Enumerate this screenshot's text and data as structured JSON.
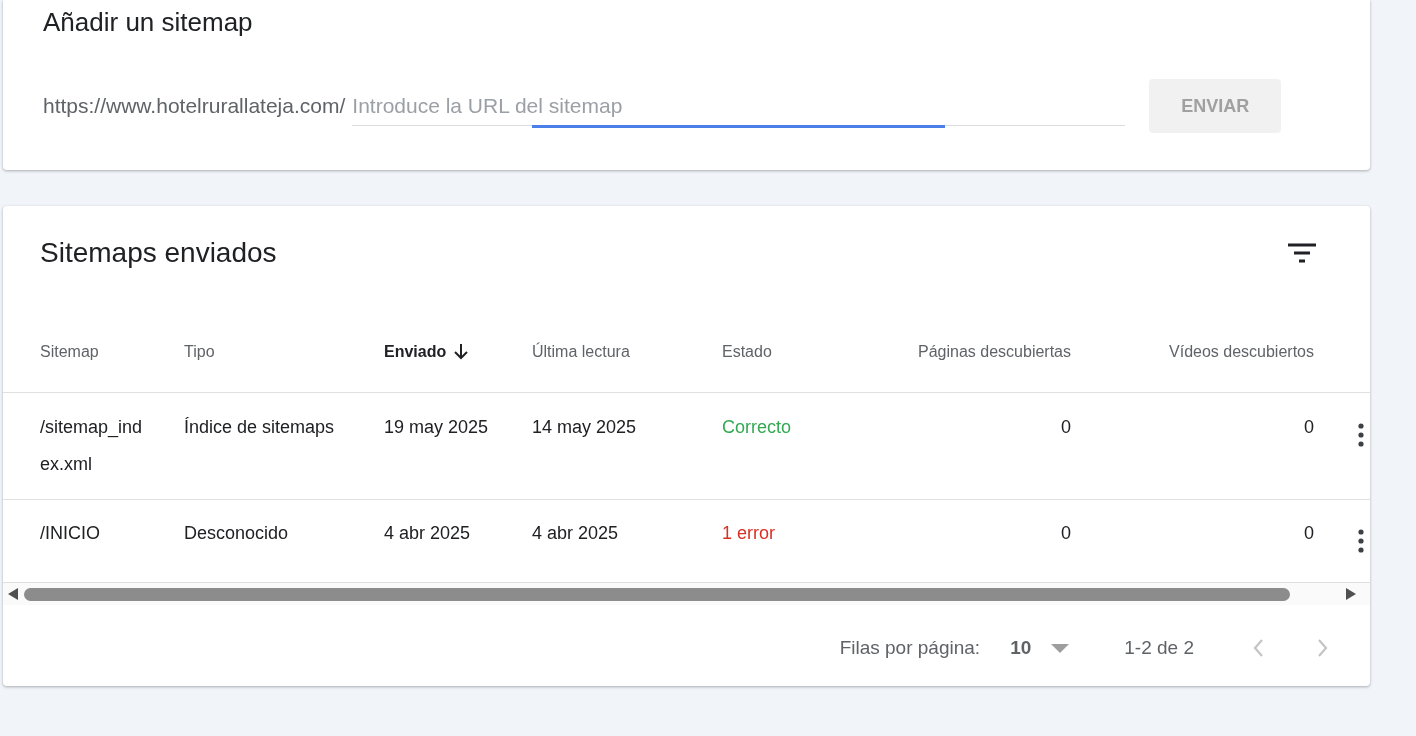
{
  "add_sitemap": {
    "title": "Añadir un sitemap",
    "url_prefix": "https://www.hotelrurallateja.com/",
    "url_field": {
      "placeholder": "Introduce la URL del sitemap",
      "focused": true
    },
    "submit_button": {
      "label": "ENVIAR",
      "disabled": true
    }
  },
  "submitted_sitemaps": {
    "title": "Sitemaps enviados",
    "table": {
      "columns": [
        {
          "label": "Sitemap",
          "sorted": false
        },
        {
          "label": "Tipo",
          "sorted": false
        },
        {
          "label": "Enviado",
          "sorted": true
        },
        {
          "label": "Última lectura",
          "sorted": false
        },
        {
          "label": "Estado",
          "sorted": false
        },
        {
          "label": "Páginas descubiertas",
          "sorted": false
        },
        {
          "label": "Vídeos descubiertos",
          "sorted": false
        }
      ],
      "rows": [
        {
          "cells": [
            "/sitemap_index.xml",
            "Índice de sitemaps",
            "19 may 2025",
            "14 may 2025",
            "Correcto",
            "0",
            "0"
          ],
          "color": "#34a853"
        },
        {
          "cells": [
            "/INICIO",
            "Desconocido",
            "4 abr 2025",
            "4 abr 2025",
            "1 error",
            "0",
            "0"
          ],
          "color": "#d93025"
        }
      ]
    },
    "pagination": {
      "rows_per_page_label": "Filas por página:",
      "rows_per_page": "10",
      "range": "1-2 de 2",
      "previous_disabled": true,
      "next_disabled": true
    }
  }
}
